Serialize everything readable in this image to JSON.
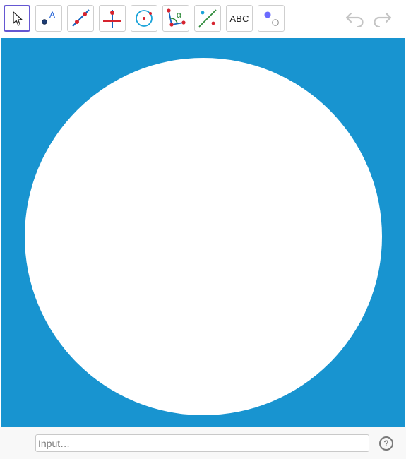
{
  "toolbar": {
    "tools": [
      {
        "name": "move-tool",
        "icon": "arrow-pointer-icon"
      },
      {
        "name": "point-tool",
        "icon": "point-icon",
        "label": "A"
      },
      {
        "name": "line-tool",
        "icon": "line-through-points-icon"
      },
      {
        "name": "perpendicular-line-tool",
        "icon": "perpendicular-line-icon"
      },
      {
        "name": "circle-tool",
        "icon": "circle-center-point-icon"
      },
      {
        "name": "angle-tool",
        "icon": "angle-icon",
        "label": "α"
      },
      {
        "name": "reflect-tool",
        "icon": "reflect-about-line-icon"
      },
      {
        "name": "text-tool",
        "icon": "text-icon",
        "label": "ABC"
      },
      {
        "name": "slider-tool",
        "icon": "show-hide-object-icon"
      }
    ],
    "undo_icon": "undo-icon",
    "redo_icon": "redo-icon"
  },
  "graphics": {
    "background_color": "#1894d0",
    "circle_fill": "#ffffff"
  },
  "input_bar": {
    "placeholder": "Input…",
    "value": "",
    "help_label": "?"
  },
  "colors": {
    "selected_border": "#6557d2",
    "point_red": "#d6232f",
    "point_dark": "#1d3c73",
    "line_blue": "#1565c0",
    "line_green": "#2e8b3a",
    "accent_cyan": "#1aa3d9"
  }
}
